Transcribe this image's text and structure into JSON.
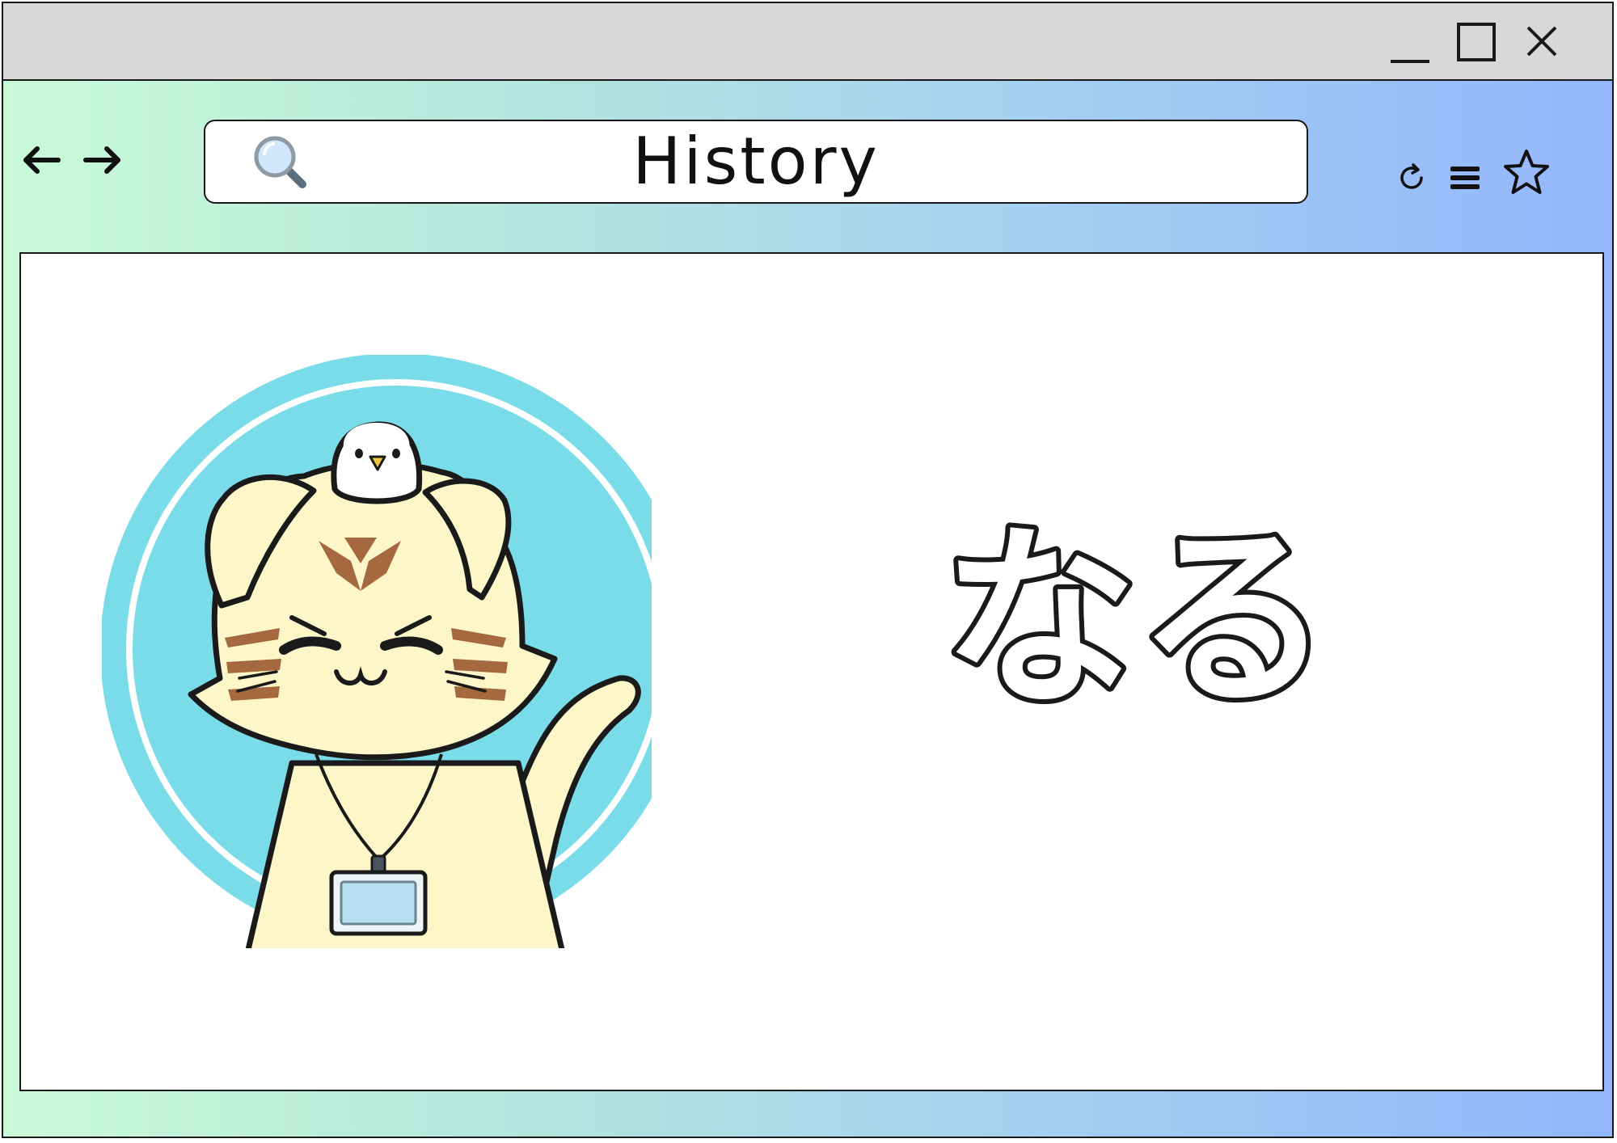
{
  "window": {
    "controls": {
      "minimize": "minimize",
      "maximize": "maximize",
      "close": "close"
    }
  },
  "navigation": {
    "back_icon": "arrow-left-icon",
    "forward_icon": "arrow-right-icon"
  },
  "address_bar": {
    "text": "History",
    "icon": "search-icon"
  },
  "toolbar": {
    "reload_icon": "reload-icon",
    "menu_icon": "hamburger-menu-icon",
    "bookmark_icon": "star-icon"
  },
  "content": {
    "illustration": "cat-with-bird-icon",
    "headline": "なる"
  },
  "colors": {
    "titlebar": "#d8d8d8",
    "gradient_start": "#c9fbd8",
    "gradient_end": "#93b6fc",
    "circle": "#7adce9",
    "cat_fur": "#fdf6c8",
    "cat_stripe": "#a5683f"
  }
}
